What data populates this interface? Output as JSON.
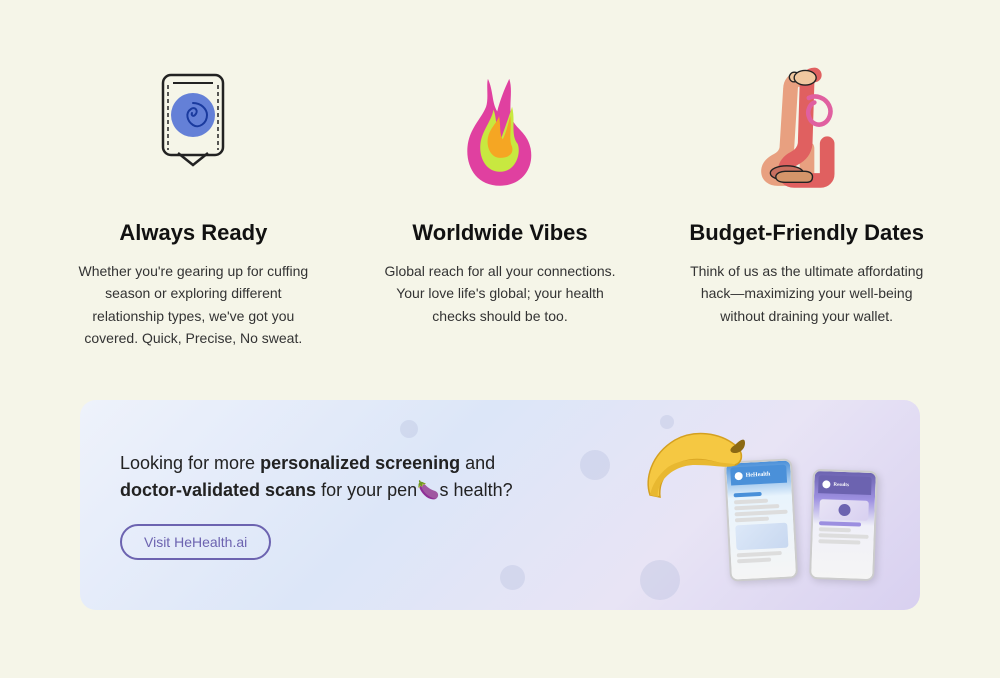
{
  "features": [
    {
      "id": "always-ready",
      "icon": "condom-icon",
      "title": "Always Ready",
      "description": "Whether you're gearing up for cuffing season or exploring different relationship types, we've got you covered. Quick, Precise, No sweat."
    },
    {
      "id": "worldwide-vibes",
      "icon": "flame-icon",
      "title": "Worldwide Vibes",
      "description": "Global reach for all your connections. Your love life's global; your health checks should be too."
    },
    {
      "id": "budget-friendly",
      "icon": "legs-icon",
      "title": "Budget-Friendly Dates",
      "description": "Think of us as the ultimate affordating hack—maximizing your well-being without draining your wallet."
    }
  ],
  "banner": {
    "text_part1": "Looking for more ",
    "text_bold1": "personalized screening",
    "text_part2": " and ",
    "text_bold2": "doctor-validated scans",
    "text_part3": " for your pen",
    "text_emoji": "🍆",
    "text_part4": "s health?",
    "button_label": "Visit HeHealth.ai"
  }
}
